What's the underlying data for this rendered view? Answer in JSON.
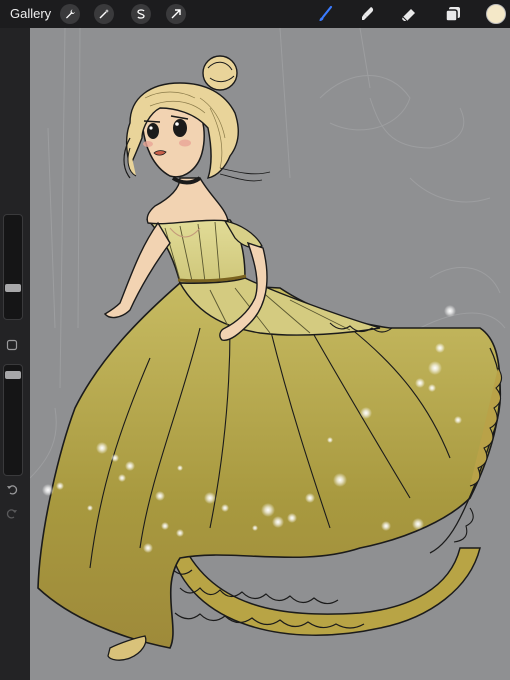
{
  "toolbar": {
    "gallery_label": "Gallery",
    "left_tools": [
      {
        "name": "actions-wrench-icon"
      },
      {
        "name": "adjustments-wand-icon"
      },
      {
        "name": "selection-s-icon"
      },
      {
        "name": "transform-arrow-icon"
      }
    ],
    "right_tools": [
      {
        "name": "brush-icon",
        "active": true
      },
      {
        "name": "smudge-icon",
        "active": false
      },
      {
        "name": "eraser-icon",
        "active": false
      },
      {
        "name": "layers-icon",
        "active": false
      }
    ],
    "current_color": "#f4e8c8",
    "accent_color": "#3a7bff"
  },
  "sidebar": {
    "brush_size_label": "",
    "opacity_label": "",
    "brush_size_level": 0.72,
    "opacity_level": 0.05
  },
  "canvas": {
    "background_color": "#8f9092",
    "dress_color": "#b8a94a",
    "skin_color": "#f2d2b0",
    "hair_color": "#e8d49a"
  }
}
